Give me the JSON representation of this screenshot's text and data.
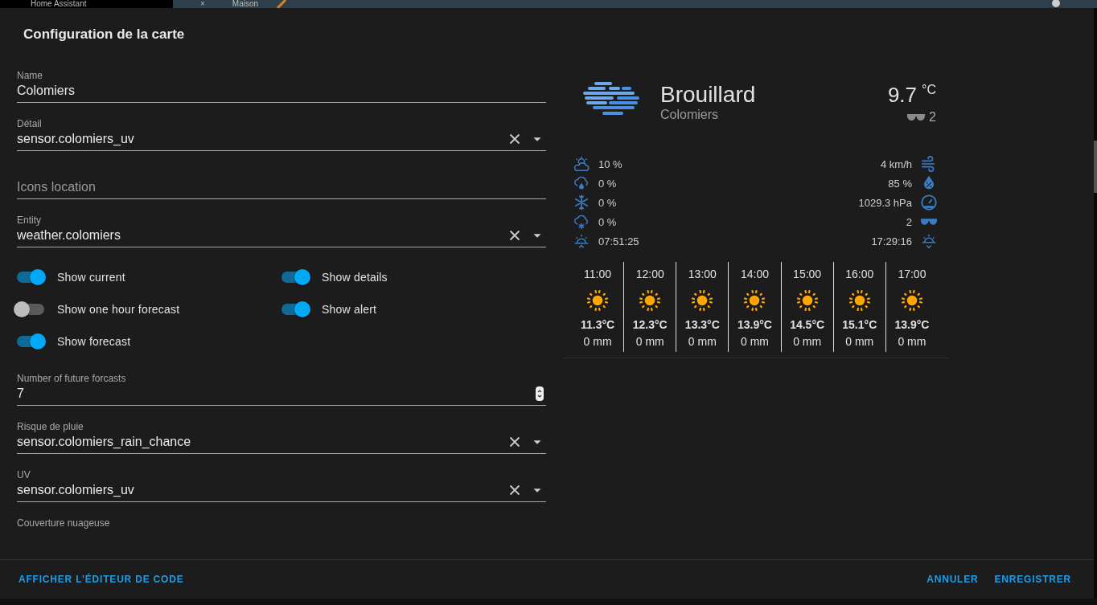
{
  "top_bar": {
    "app_title": "Home Assistant",
    "tab_close": "×",
    "tab_title": "Maison"
  },
  "dialog": {
    "title": "Configuration de la carte"
  },
  "fields": [
    {
      "kind": "text",
      "label": "Name",
      "value": "Colomiers"
    },
    {
      "kind": "select",
      "label": "Détail",
      "value": "sensor.colomiers_uv"
    },
    {
      "kind": "empty",
      "label": "Icons location"
    },
    {
      "kind": "select",
      "label": "Entity",
      "value": "weather.colomiers"
    },
    {
      "kind": "toggles",
      "items": [
        {
          "label": "Show current",
          "on": true
        },
        {
          "label": "Show one hour forecast",
          "on": false
        },
        {
          "label": "Show forecast",
          "on": true
        },
        {
          "label": "Show details",
          "on": true
        },
        {
          "label": "Show alert",
          "on": true
        }
      ]
    },
    {
      "kind": "number",
      "label": "Number of future forcasts",
      "value": "7"
    },
    {
      "kind": "select",
      "label": "Risque de pluie",
      "value": "sensor.colomiers_rain_chance"
    },
    {
      "kind": "select",
      "label": "UV",
      "value": "sensor.colomiers_uv"
    },
    {
      "kind": "select",
      "label": "Couverture nuageuse"
    }
  ],
  "weather": {
    "condition": "Brouillard",
    "location": "Colomiers",
    "temperature": "9.7",
    "unit": "°C",
    "uv": "2",
    "details_left": [
      {
        "kind": "cloud_cover",
        "value": "10 %"
      },
      {
        "kind": "rain",
        "value": "0 %"
      },
      {
        "kind": "frost",
        "value": "0 %"
      },
      {
        "kind": "snow",
        "value": "0 %"
      },
      {
        "kind": "sunrise",
        "value": "07:51:25"
      }
    ],
    "details_right": [
      {
        "kind": "wind",
        "value": "4 km/h"
      },
      {
        "kind": "humidity",
        "value": "85 %"
      },
      {
        "kind": "pressure",
        "value": "1029.3 hPa"
      },
      {
        "kind": "uv",
        "value": "2"
      },
      {
        "kind": "sunset",
        "value": "17:29:16"
      }
    ],
    "forecast": [
      {
        "time": "11:00",
        "kind": "sunny",
        "temperature": "11.3°C",
        "precipitation": "0 mm"
      },
      {
        "time": "12:00",
        "kind": "sunny",
        "temperature": "12.3°C",
        "precipitation": "0 mm"
      },
      {
        "time": "13:00",
        "kind": "sunny",
        "temperature": "13.3°C",
        "precipitation": "0 mm"
      },
      {
        "time": "14:00",
        "kind": "sunny",
        "temperature": "13.9°C",
        "precipitation": "0 mm"
      },
      {
        "time": "15:00",
        "kind": "sunny",
        "temperature": "14.5°C",
        "precipitation": "0 mm"
      },
      {
        "time": "16:00",
        "kind": "sunny",
        "temperature": "15.1°C",
        "precipitation": "0 mm"
      },
      {
        "time": "17:00",
        "kind": "sunny",
        "temperature": "13.9°C",
        "precipitation": "0 mm"
      }
    ]
  },
  "footer": {
    "left": "AFFICHER L’ÉDITEUR DE CODE",
    "right": [
      "ANNULER",
      "ENREGISTRER"
    ]
  }
}
